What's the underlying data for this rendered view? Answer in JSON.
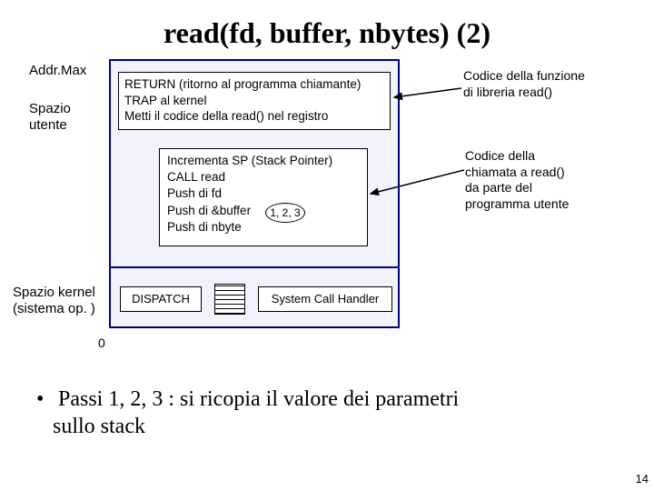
{
  "title": "read(fd, buffer, nbytes) (2)",
  "labels": {
    "addr_max": "Addr.Max",
    "spazio_utente_l1": "Spazio",
    "spazio_utente_l2": "utente",
    "spazio_kernel_l1": "Spazio kernel",
    "spazio_kernel_l2": "(sistema op. )",
    "zero": "0"
  },
  "boxes": {
    "return_l1": "RETURN (ritorno al programma chiamante)",
    "return_l2": "TRAP al kernel",
    "return_l3": "Metti il codice della read() nel registro",
    "inc_l1": "Incrementa SP (Stack Pointer)",
    "inc_l2": "CALL read",
    "inc_l3": "Push di fd",
    "inc_l4": "Push di &buffer",
    "inc_l5": "Push di nbyte",
    "steps": "1, 2, 3",
    "dispatch": "DISPATCH",
    "sch": "System Call Handler"
  },
  "annotations": {
    "a1_l1": "Codice della funzione",
    "a1_l2": "di libreria read()",
    "a2_l1": "Codice della",
    "a2_l2": "chiamata a read()",
    "a2_l3": "da parte del",
    "a2_l4": "programma utente"
  },
  "bullet": {
    "text_l1": "Passi 1, 2, 3 : si ricopia il valore dei parametri",
    "text_l2": "sullo stack"
  },
  "page_number": "14"
}
